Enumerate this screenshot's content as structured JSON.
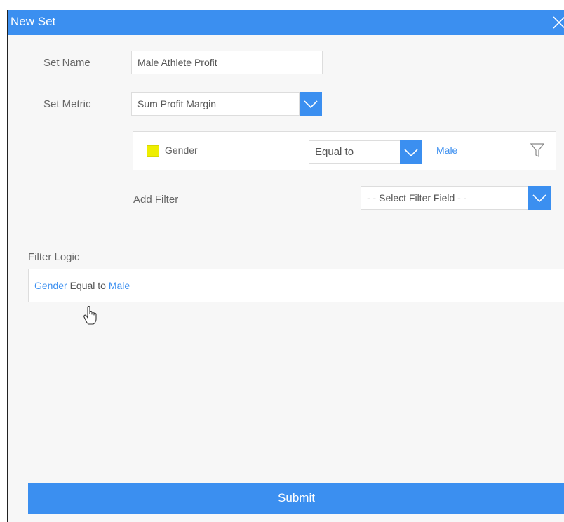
{
  "dialog": {
    "title": "New Set",
    "close_icon": "close-icon"
  },
  "form": {
    "set_name_label": "Set Name",
    "set_name_value": "Male Athlete Profit",
    "set_metric_label": "Set Metric",
    "set_metric_value": "Sum Profit Margin"
  },
  "filter": {
    "swatch_color": "#eeee00",
    "field": "Gender",
    "operator": "Equal to",
    "value": "Male",
    "icon": "funnel-icon"
  },
  "add_filter": {
    "label": "Add Filter",
    "placeholder": "- - Select Filter Field - -"
  },
  "filter_logic": {
    "label": "Filter Logic",
    "field": "Gender",
    "operator": "Equal to",
    "value": "Male"
  },
  "submit_label": "Submit",
  "colors": {
    "accent": "#3b8ff0",
    "background": "#f7f7f7"
  }
}
